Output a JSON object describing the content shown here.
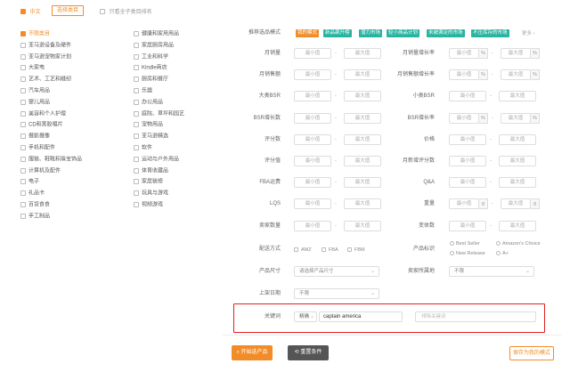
{
  "top": {
    "language_label": "中文",
    "select_category_button": "选择类目",
    "only_parent_label": "只看全子类目排名"
  },
  "categories_left": [
    "不限类目",
    "亚马逊设备及硬件",
    "亚马逊宠物家计划",
    "大家电",
    "艺术、工艺和缝纫",
    "汽车用品",
    "婴儿用品",
    "美容和个人护理",
    "CD和黑胶唱片",
    "摄影摄像",
    "手机和配件",
    "服装、鞋靴和珠宝饰品",
    "计算机及配件",
    "电子",
    "礼品卡",
    "百货食食",
    "手工制品"
  ],
  "categories_right": [
    "健康和家用用品",
    "家居厨房用品",
    "工业和科学",
    "Kindle商店",
    "厨房和餐厅",
    "乐器",
    "办公用品",
    "庭院、草坪和园艺",
    "宠物用品",
    "亚马逊精选",
    "软件",
    "运动与户外用品",
    "体育收藏品",
    "家居装修",
    "玩具与游戏",
    "视频游戏"
  ],
  "modes": {
    "label": "推荐选品模式",
    "tags": [
      {
        "text": "我的模式",
        "color": "#f28c28"
      },
      {
        "text": "新品飙升榜",
        "color": "#27b4a0"
      },
      {
        "text": "潜力市场",
        "color": "#27b4a0"
      },
      {
        "text": "轻小商品计划",
        "color": "#27b4a0"
      },
      {
        "text": "未被满足的市场",
        "color": "#27b4a0"
      },
      {
        "text": "不压库存的市场",
        "color": "#27b4a0"
      }
    ],
    "more": "更多 ›"
  },
  "placeholders": {
    "min": "最小值",
    "max": "最大值"
  },
  "left_filters": [
    {
      "label": "月销量"
    },
    {
      "label": "月销售额"
    },
    {
      "label": "大类BSR"
    },
    {
      "label": "BSR增长数"
    },
    {
      "label": "评分数"
    },
    {
      "label": "评分值"
    },
    {
      "label": "FBA运费"
    },
    {
      "label": "LQS"
    },
    {
      "label": "卖家数量"
    }
  ],
  "right_filters": [
    {
      "label": "月销量增长率",
      "unit": "%"
    },
    {
      "label": "月销售额增长率",
      "unit": "%"
    },
    {
      "label": "小类BSR",
      "unit": ""
    },
    {
      "label": "BSR增长率",
      "unit": "%"
    },
    {
      "label": "价格",
      "unit": ""
    },
    {
      "label": "月新增评分数",
      "unit": ""
    },
    {
      "label": "Q&A",
      "unit": ""
    },
    {
      "label": "重量",
      "unit": "g"
    },
    {
      "label": "变体数",
      "unit": ""
    }
  ],
  "delivery": {
    "label": "配送方式",
    "options": [
      "AMZ",
      "FBA",
      "FBM"
    ]
  },
  "product_tags": {
    "label": "产品标识",
    "options": [
      "Best Seller",
      "Amazon's Choice",
      "New Release",
      "A+"
    ]
  },
  "size": {
    "label": "产品尺寸",
    "placeholder": "请选择产品尺寸"
  },
  "seller_location": {
    "label": "卖家所属地",
    "value": "不限"
  },
  "listing_date": {
    "label": "上架日期",
    "value": "不限"
  },
  "keyword": {
    "label": "关键词",
    "match_mode": "精确",
    "value": "captain america",
    "exclude_placeholder": "排除关键词"
  },
  "actions": {
    "search": "开始选产品",
    "reset": "重置条件",
    "save": "保存为我的模式"
  },
  "colors": {
    "accent": "#f28c28",
    "teal": "#27b4a0",
    "highlight": "#e02020"
  }
}
